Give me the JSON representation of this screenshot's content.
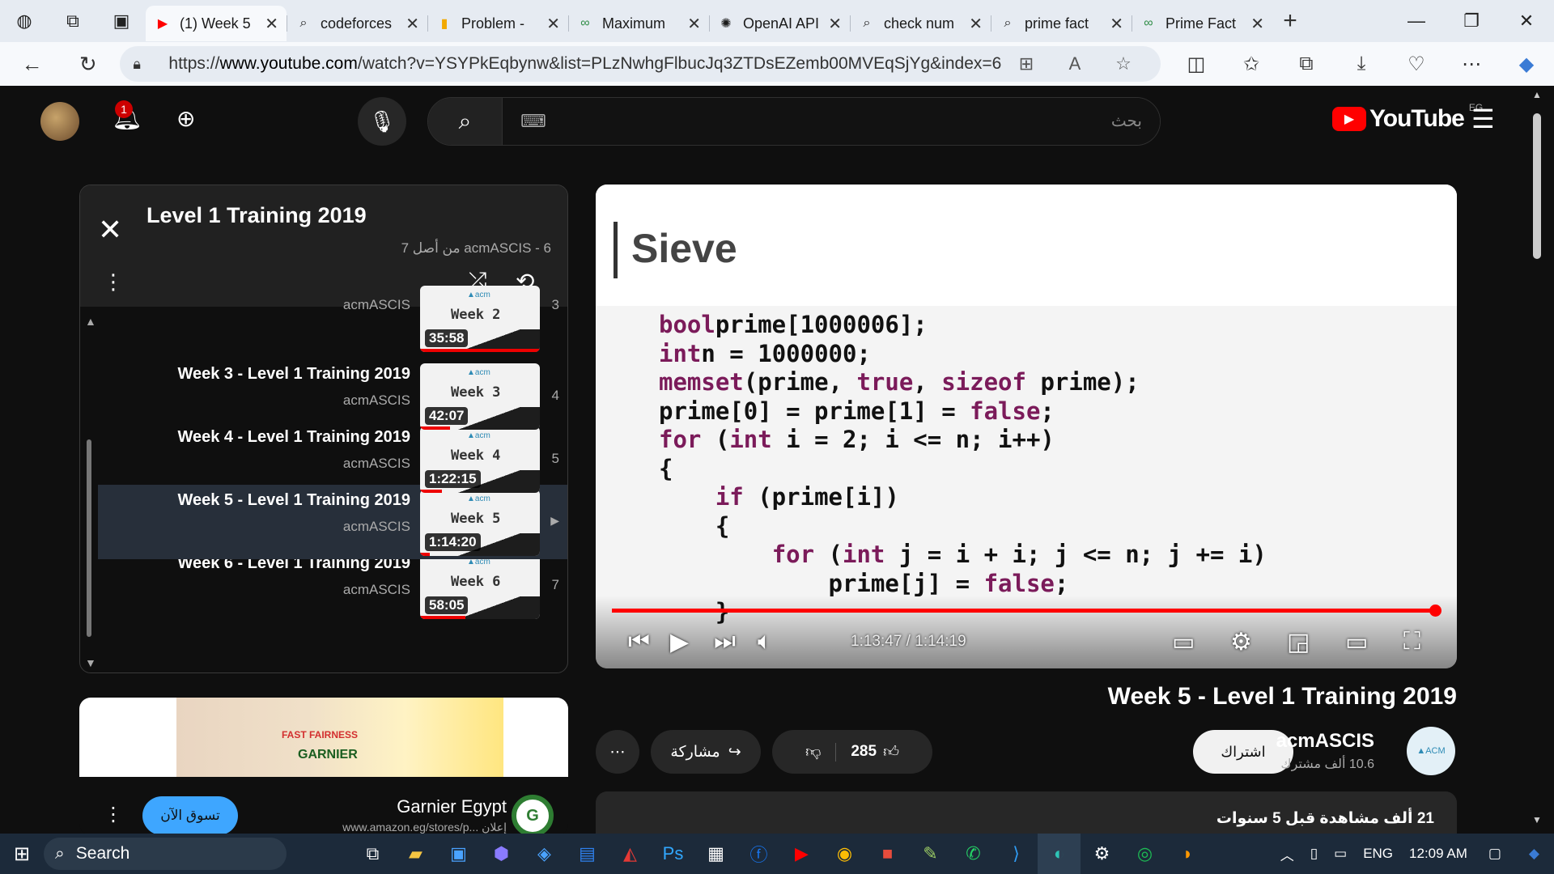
{
  "browser": {
    "tabs": [
      {
        "label": "(1) Week 5",
        "icon": "youtube-icon",
        "color": "#ff0000",
        "active": true
      },
      {
        "label": "codeforces",
        "icon": "search-icon"
      },
      {
        "label": "Problem -",
        "icon": "chart-icon"
      },
      {
        "label": "Maximum",
        "icon": "gfg-icon"
      },
      {
        "label": "OpenAI API",
        "icon": "openai-icon"
      },
      {
        "label": "check num",
        "icon": "search-icon"
      },
      {
        "label": "prime fact",
        "icon": "search-icon"
      },
      {
        "label": "Prime Fact",
        "icon": "gfg-icon"
      }
    ],
    "url_prefix": "https://",
    "url_host": "www.youtube.com",
    "url_path": "/watch?v=YSYPkEqbynw&list=PLzNwhgFlbucJq3ZTDsEZemb00MVEqSjYg&index=6"
  },
  "youtube": {
    "notifications_count": "1",
    "search_placeholder": "بحث",
    "logo_text": "YouTube",
    "country_code": "EG",
    "playlist": {
      "title": "Level 1 Training 2019",
      "subtitle": "acmASCIS - 6 من أصل 7",
      "items": [
        {
          "index": "3",
          "title": "",
          "channel": "acmASCIS",
          "week": "Week 2",
          "duration": "35:58",
          "progress": 1.0
        },
        {
          "index": "4",
          "title": "Week 3 - Level 1 Training 2019",
          "channel": "acmASCIS",
          "week": "Week 3",
          "duration": "42:07",
          "progress": 0.25
        },
        {
          "index": "5",
          "title": "Week 4 - Level 1 Training 2019",
          "channel": "acmASCIS",
          "week": "Week 4",
          "duration": "1:22:15",
          "progress": 0.18
        },
        {
          "index": "",
          "title": "Week 5 - Level 1 Training 2019",
          "channel": "acmASCIS",
          "week": "Week 5",
          "duration": "1:14:20",
          "progress": 0.08,
          "current": true
        },
        {
          "index": "7",
          "title": "Week 6 - Level 1 Training 2019",
          "channel": "acmASCIS",
          "week": "Week 6",
          "duration": "58:05",
          "progress": 0.38
        }
      ]
    },
    "ad": {
      "advertiser": "Garnier Egypt",
      "url": "www.amazon.eg/stores/p... إعلان",
      "cta": "تسوق الآن",
      "banner_brand": "GARNIER",
      "banner_tagline": "FAST FAIRNESS"
    },
    "video": {
      "slide_title": "Sieve",
      "code_lines": [
        [
          [
            "kw",
            "bool"
          ],
          [
            "",
            "prime[1000006];"
          ]
        ],
        [
          [
            "kw",
            "int"
          ],
          [
            "",
            "n = 1000000;"
          ]
        ],
        [
          [
            "kw",
            "memset"
          ],
          [
            "",
            "(prime, "
          ],
          [
            "kw",
            "true"
          ],
          [
            "",
            ", "
          ],
          [
            "kw",
            "sizeof"
          ],
          [
            "",
            " prime);"
          ]
        ],
        [
          [
            "",
            "prime[0] = prime[1] = "
          ],
          [
            "kw",
            "false"
          ],
          [
            "",
            ";"
          ]
        ],
        [
          [
            "kw",
            "for"
          ],
          [
            "",
            " ("
          ],
          [
            "kw",
            "int"
          ],
          [
            "",
            " i = 2; i <= n; i++)"
          ]
        ],
        [
          [
            "",
            "{"
          ]
        ],
        [
          [
            "",
            "    "
          ],
          [
            "kw",
            "if"
          ],
          [
            "",
            " (prime[i])"
          ]
        ],
        [
          [
            "",
            "    {"
          ]
        ],
        [
          [
            "",
            "        "
          ],
          [
            "kw",
            "for"
          ],
          [
            "",
            " ("
          ],
          [
            "kw",
            "int"
          ],
          [
            "",
            " j = i + i; j <= n; j += i)"
          ]
        ],
        [
          [
            "",
            "            prime[j] = "
          ],
          [
            "kw",
            "false"
          ],
          [
            "",
            ";"
          ]
        ],
        [
          [
            "",
            "    }"
          ]
        ]
      ],
      "time_current": "1:13:47",
      "time_total": "1:14:19",
      "progress": 0.993,
      "title": "Week 5 - Level 1 Training 2019"
    },
    "channel": {
      "name": "acmASCIS",
      "subscribers": "10.6 ألف مشترك",
      "subscribe_label": "اشتراك"
    },
    "actions": {
      "likes": "285",
      "share_label": "مشاركة"
    },
    "description": {
      "stats": "21 ألف مشاهدة  قبل 5 سنوات"
    }
  },
  "taskbar": {
    "search_label": "Search",
    "language": "ENG",
    "clock": "12:09 AM"
  }
}
